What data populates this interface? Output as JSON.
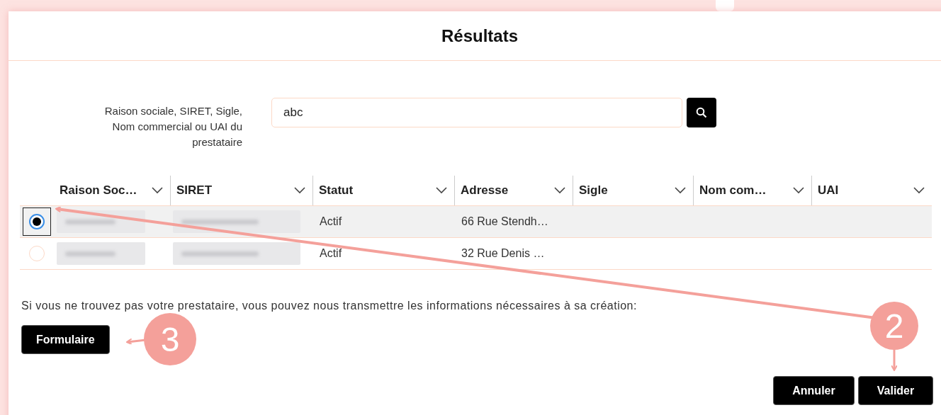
{
  "dialog": {
    "title": "Résultats"
  },
  "search": {
    "label": "Raison sociale, SIRET, Sigle, Nom commercial ou UAI du prestataire",
    "value": "abc"
  },
  "table": {
    "columns": [
      "Raison Soc…",
      "SIRET",
      "Statut",
      "Adresse",
      "Sigle",
      "Nom com…",
      "UAI"
    ],
    "rows": [
      {
        "selected": true,
        "cells": [
          {
            "kind": "blurred"
          },
          {
            "kind": "blurred"
          },
          {
            "kind": "text",
            "text": "Actif"
          },
          {
            "kind": "text",
            "text": "66 Rue Stendh…"
          }
        ]
      },
      {
        "selected": false,
        "cells": [
          {
            "kind": "blurred"
          },
          {
            "kind": "blurred"
          },
          {
            "kind": "text",
            "text": "Actif"
          },
          {
            "kind": "text",
            "text": "32 Rue Denis …"
          }
        ]
      }
    ]
  },
  "message": "Si vous ne trouvez pas votre prestataire, vous pouvez nous transmettre les informations nécessaires à sa création:",
  "form_button": "Formulaire",
  "footer_buttons": [
    "Annuler",
    "Valider"
  ],
  "annotations": [
    {
      "label": "3"
    },
    {
      "label": "2"
    }
  ]
}
